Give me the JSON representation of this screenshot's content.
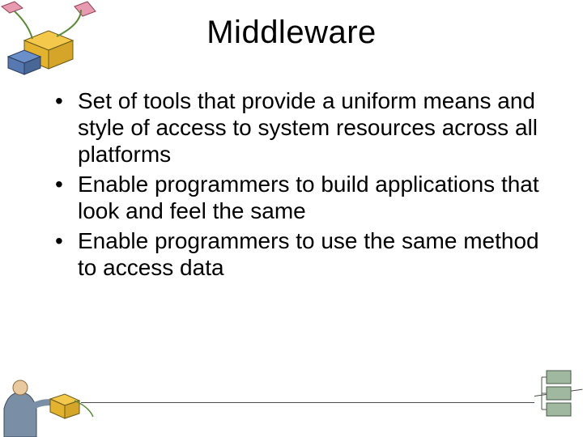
{
  "title": "Middleware",
  "bullets": [
    "Set of tools that provide a uniform means and style of access to system resources across all platforms",
    "Enable programmers to build applications that look and feel the same",
    "Enable programmers to use the same method to access data"
  ],
  "art": {
    "top_left": "clipart-cubes-top-left",
    "bottom_left": "clipart-person-cube-bottom-left",
    "bottom_right": "clipart-stack-bottom-right"
  }
}
